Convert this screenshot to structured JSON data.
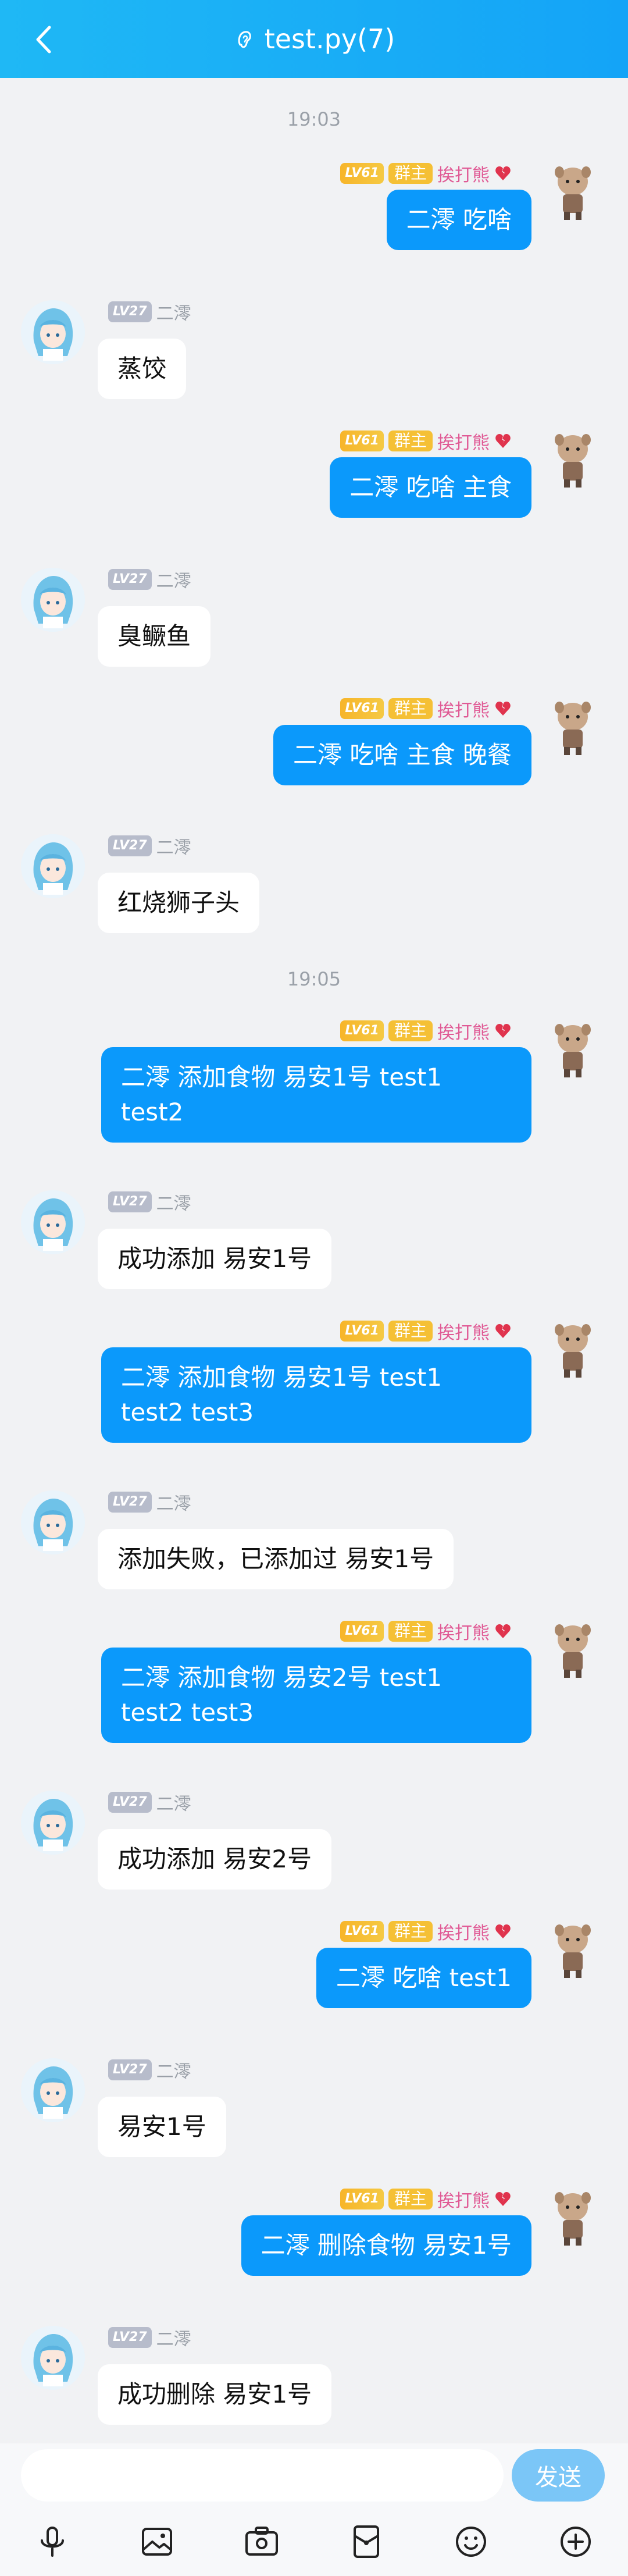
{
  "header": {
    "title": "test.py(7)"
  },
  "timestamps": [
    "19:03",
    "19:05"
  ],
  "users": {
    "me": {
      "level": "LV61",
      "role": "群主",
      "nick": "挨打熊"
    },
    "bot": {
      "level": "LV27",
      "nick": "二澪"
    }
  },
  "messages": [
    {
      "text": "二澪 吃啥"
    },
    {
      "text": "蒸饺"
    },
    {
      "text": "二澪 吃啥 主食"
    },
    {
      "text": "臭鳜鱼"
    },
    {
      "text": "二澪 吃啥 主食 晚餐"
    },
    {
      "text": "红烧狮子头"
    },
    {
      "text": "二澪 添加食物 易安1号 test1\ntest2"
    },
    {
      "text": "成功添加 易安1号"
    },
    {
      "text": "二澪 添加食物 易安1号 test1\ntest2 test3"
    },
    {
      "text": "添加失败，已添加过 易安1号"
    },
    {
      "text": "二澪 添加食物 易安2号 test1\ntest2 test3"
    },
    {
      "text": "成功添加 易安2号"
    },
    {
      "text": "二澪 吃啥 test1"
    },
    {
      "text": "易安1号"
    },
    {
      "text": "二澪 删除食物 易安1号"
    },
    {
      "text": "成功删除 易安1号"
    }
  ],
  "input": {
    "placeholder": "",
    "send_label": "发送"
  },
  "toolbar": {
    "icons": [
      "microphone-icon",
      "image-icon",
      "camera-icon",
      "red-packet-icon",
      "emoji-icon",
      "plus-icon"
    ]
  },
  "colors": {
    "header": "#14a4f7",
    "my_bubble": "#0b99fb",
    "their_bubble": "#ffffff",
    "background": "#f1f2f4",
    "send_button": "#7bc6f7"
  }
}
